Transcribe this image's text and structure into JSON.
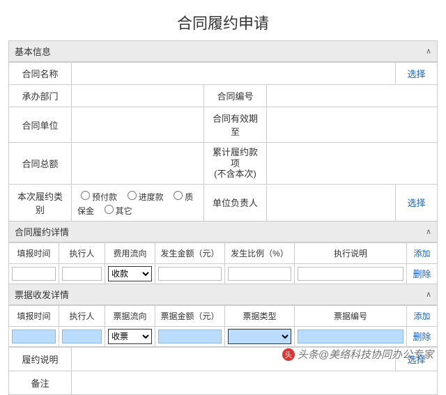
{
  "title": "合同履约申请",
  "sections": {
    "basic": {
      "header": "基本信息"
    },
    "perf": {
      "header": "合同履约详情"
    },
    "ticket": {
      "header": "票据收发详情"
    }
  },
  "labels": {
    "contractName": "合同名称",
    "dept": "承办部门",
    "contractNo": "合同编号",
    "contractUnit": "合同单位",
    "validUntil": "合同有效期至",
    "totalAmount": "合同总额",
    "cumulative": "累计履约款项\n(不含本次)",
    "perfType": "本次履约类别",
    "unitLeader": "单位负责人",
    "perfDesc": "履约说明",
    "remark": "备注"
  },
  "radios": {
    "r1": "预付款",
    "r2": "进度款",
    "r3": "质保金",
    "r4": "其它"
  },
  "actions": {
    "select": "选择",
    "add": "添加",
    "del": "删除"
  },
  "perfCols": {
    "c1": "填报时间",
    "c2": "执行人",
    "c3": "费用流向",
    "c4": "发生金额（元）",
    "c5": "发生比例（%）",
    "c6": "执行说明"
  },
  "perfRow": {
    "flowOpt": "收款"
  },
  "ticketCols": {
    "c1": "填报时间",
    "c2": "执行人",
    "c3": "票据流向",
    "c4": "票据金额（元）",
    "c5": "票据类型",
    "c6": "票据编号"
  },
  "ticketRow": {
    "flowOpt": "收票"
  },
  "watermark": "头条@美络科技协同办公专家"
}
